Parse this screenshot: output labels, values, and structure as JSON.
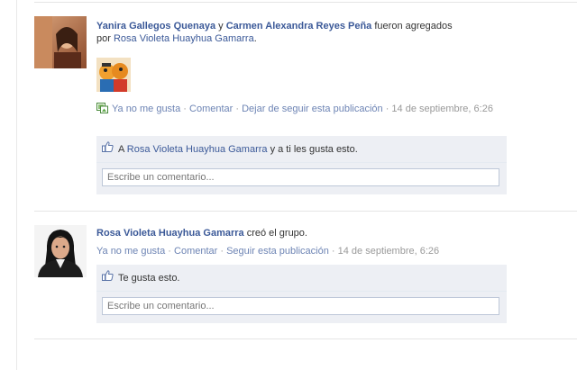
{
  "post1": {
    "actor1": "Yanira Gallegos Quenaya",
    "conj": " y ",
    "actor2": "Carmen Alexandra Reyes Peña",
    "verb": " fueron agregados",
    "by": "por ",
    "adder": "Rosa Violeta Huayhua Gamarra",
    "period": ".",
    "actions": {
      "unlike": "Ya no me gusta",
      "comment": "Comentar",
      "unfollow": "Dejar de seguir esta publicación",
      "sep": " · ",
      "time": "14 de septiembre, 6:26"
    },
    "likes": {
      "prefix": "A ",
      "name": "Rosa Violeta Huayhua Gamarra",
      "suffix": " y a ti les gusta esto."
    },
    "comment_placeholder": "Escribe un comentario..."
  },
  "post2": {
    "actor": "Rosa Violeta Huayhua Gamarra",
    "verb": " creó el grupo.",
    "actions": {
      "unlike": "Ya no me gusta",
      "comment": "Comentar",
      "follow": "Seguir esta publicación",
      "sep": " · ",
      "time": "14 de septiembre, 6:26"
    },
    "likes": {
      "text": "Te gusta esto."
    },
    "comment_placeholder": "Escribe un comentario..."
  },
  "colors": {
    "link": "#3b5998",
    "ufi_bg": "#edeff4",
    "border": "#bdc7d8"
  }
}
